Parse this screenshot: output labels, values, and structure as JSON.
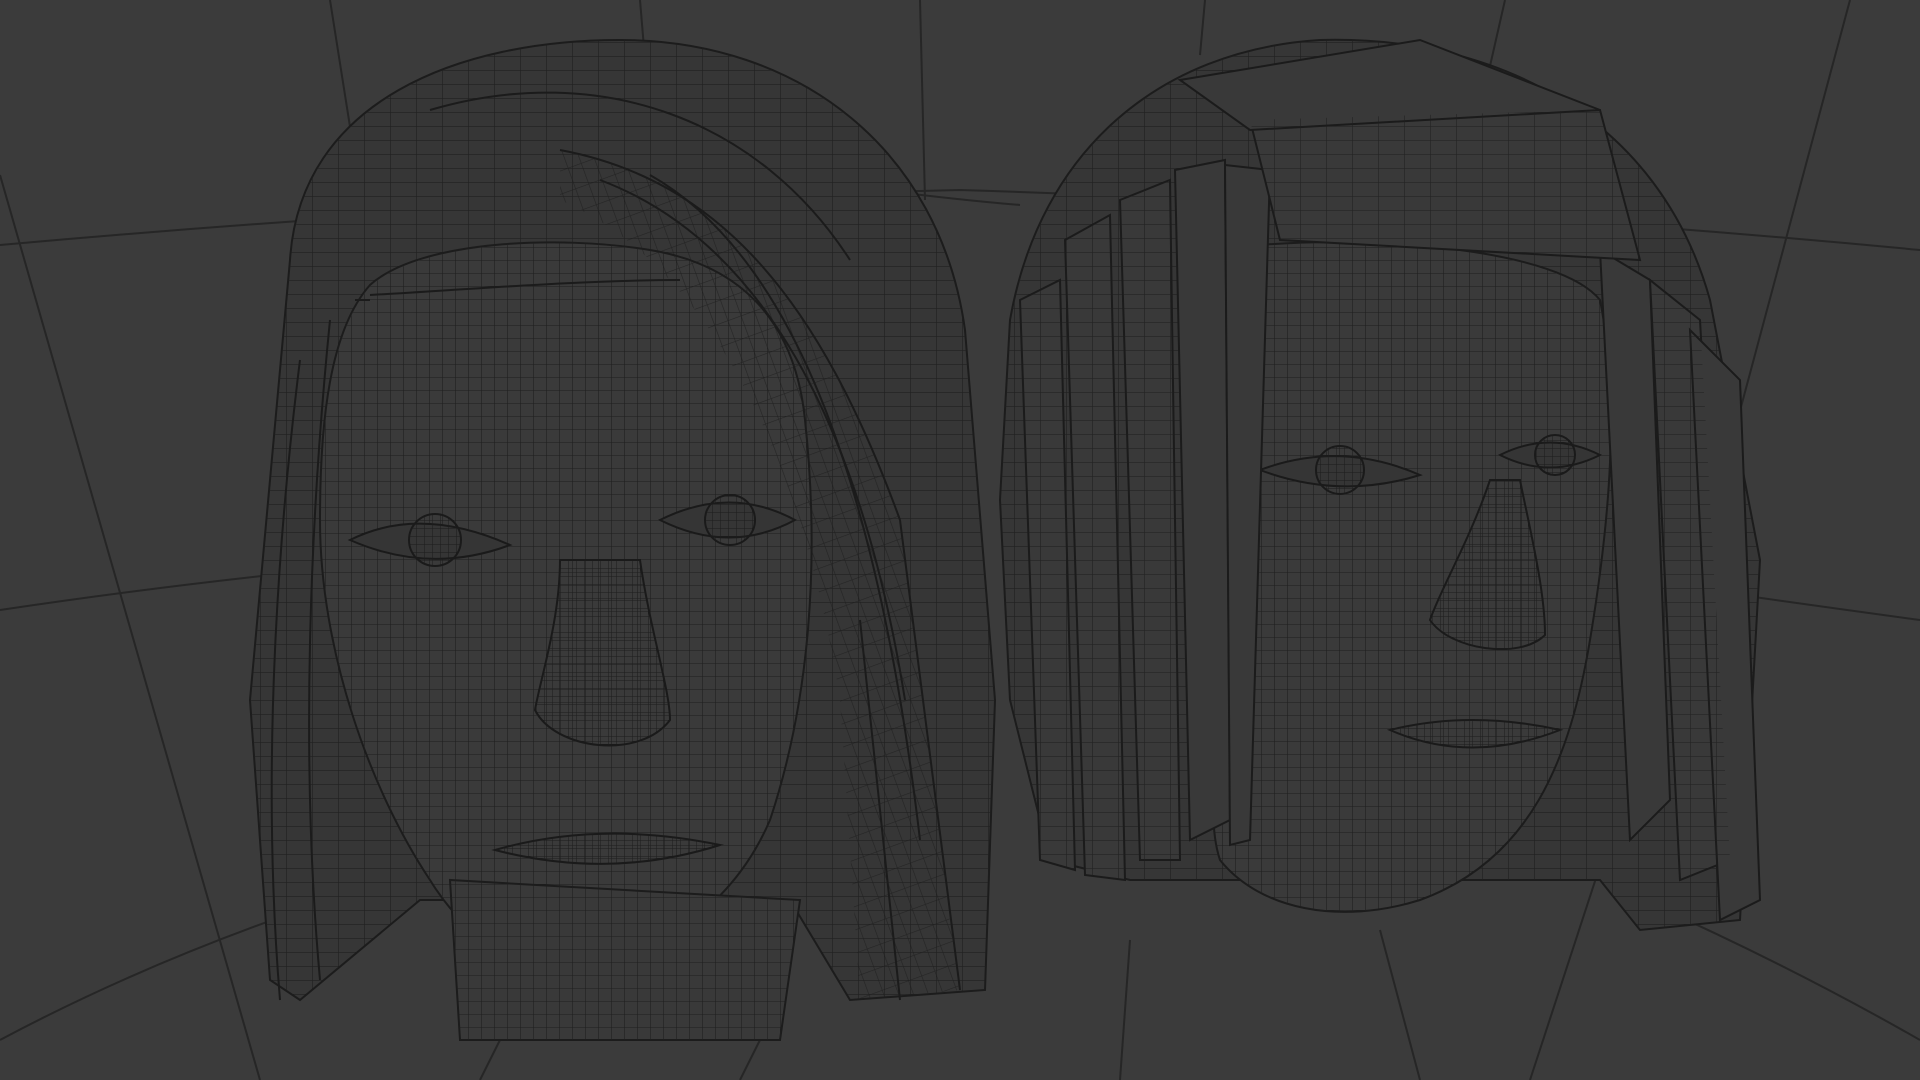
{
  "viewport": {
    "shading": "wireframe",
    "background_color": "#3b3b3b",
    "wire_color": "#1f1f1f",
    "grid_color": "#262626"
  },
  "scene": {
    "objects": [
      {
        "name": "head-left",
        "view": "front",
        "hair": "long-strands"
      },
      {
        "name": "head-right",
        "view": "three-quarter",
        "hair": "blocky-strands"
      }
    ]
  }
}
